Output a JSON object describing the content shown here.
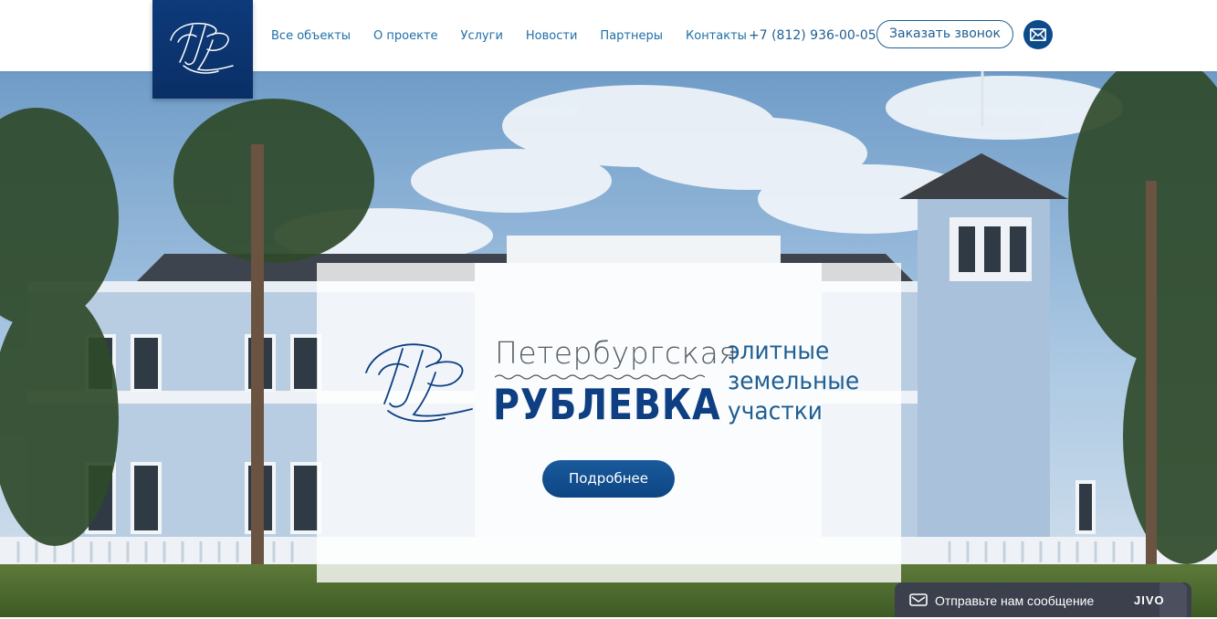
{
  "header": {
    "nav": [
      {
        "label": "Все объекты"
      },
      {
        "label": "О проекте"
      },
      {
        "label": "Услуги"
      },
      {
        "label": "Новости"
      },
      {
        "label": "Партнеры"
      },
      {
        "label": "Контакты"
      }
    ],
    "phone": "+7 (812) 936-00-05",
    "call_button": "Заказать звонок",
    "mail_icon": "envelope-icon"
  },
  "hero": {
    "brand_top": "Петербургская",
    "brand_main": "РУБЛЕВКА",
    "tagline": [
      "элитные",
      "земельные",
      "участки"
    ],
    "more_button": "Подробнее"
  },
  "jivo": {
    "message": "Отправьте нам сообщение",
    "brand": "JIVO",
    "icon": "chat-icon"
  },
  "colors": {
    "brand_blue": "#0d3f82",
    "link_blue": "#1f6fa8",
    "widget_dark": "#3c3f4c"
  }
}
